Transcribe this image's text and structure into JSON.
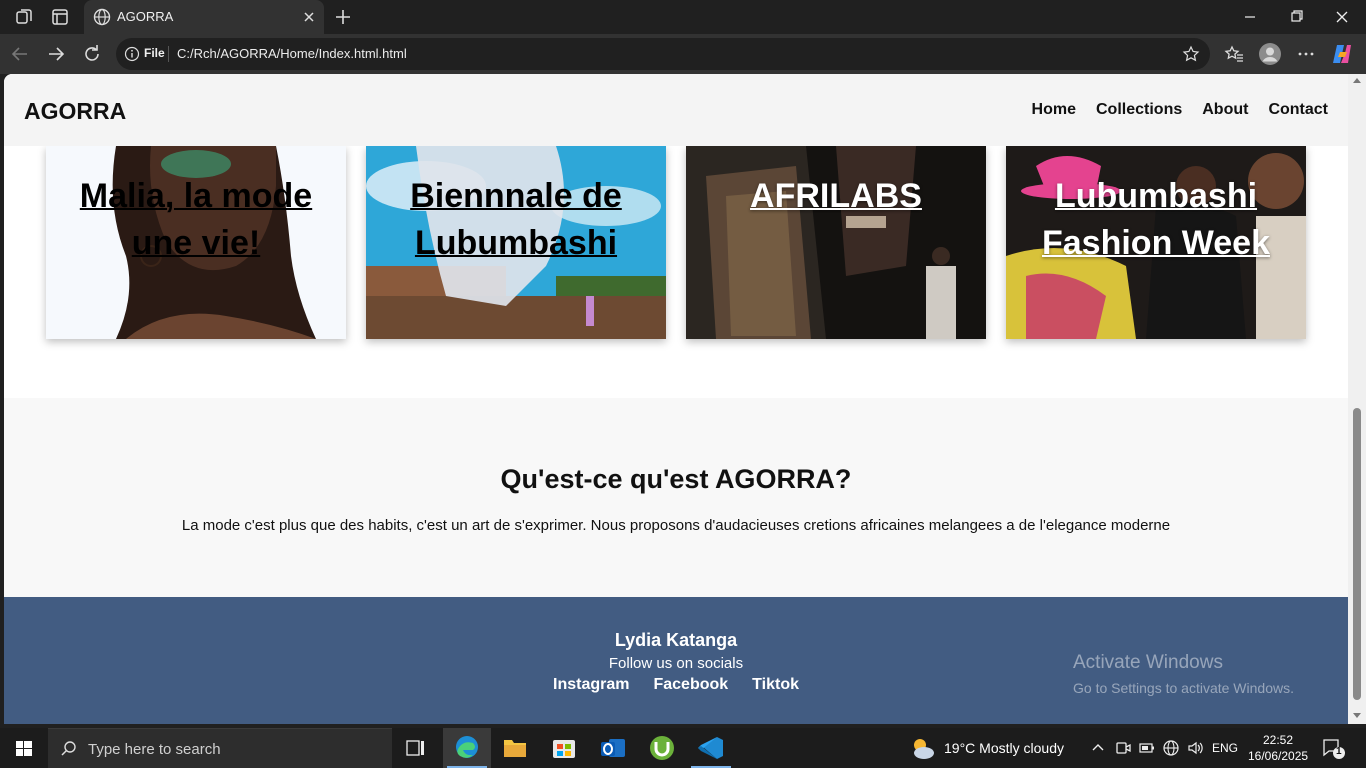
{
  "browser": {
    "tab_title": "AGORRA",
    "address_scheme": "File",
    "address_url": "C:/Rch/AGORRA/Home/Index.html.html"
  },
  "site": {
    "brand": "AGORRA",
    "nav": [
      "Home",
      "Collections",
      "About",
      "Contact"
    ],
    "cards": [
      {
        "title_line1": "Malia, la mode",
        "title_line2": "une vie!",
        "text_color": "dark"
      },
      {
        "title_line1": "Biennnale de",
        "title_line2": "Lubumbashi",
        "text_color": "dark"
      },
      {
        "title_line1": "AFRILABS",
        "title_line2": "",
        "text_color": "light"
      },
      {
        "title_line1": "Lubumbashi",
        "title_line2": "Fashion Week",
        "text_color": "light"
      }
    ],
    "about": {
      "heading": "Qu'est-ce qu'est AGORRA?",
      "text": "La mode c'est plus que des habits, c'est un art de s'exprimer. Nous proposons d'audacieuses cretions africaines melangees a de l'elegance moderne"
    },
    "footer": {
      "name": "Lydia Katanga",
      "follow": "Follow us on socials",
      "links": [
        "Instagram",
        "Facebook",
        "Tiktok"
      ],
      "footer_color": "#425c82"
    }
  },
  "watermark": {
    "line1": "Activate Windows",
    "line2": "Go to Settings to activate Windows."
  },
  "taskbar": {
    "search_placeholder": "Type here to search",
    "weather": "19°C  Mostly cloudy",
    "language": "ENG",
    "time": "22:52",
    "date": "16/06/2025",
    "notification_count": "1"
  }
}
